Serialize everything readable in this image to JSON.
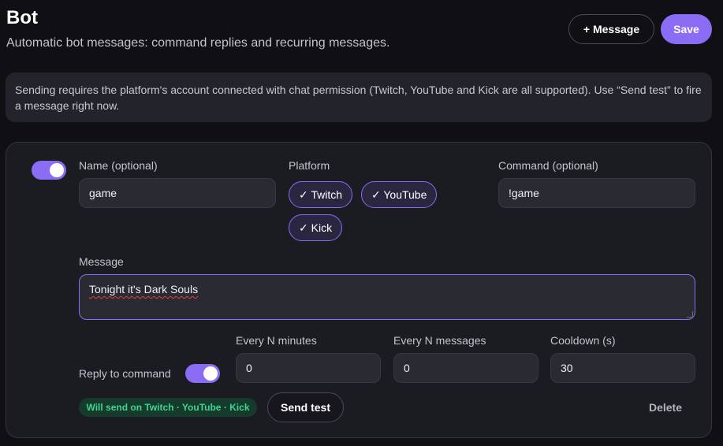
{
  "header": {
    "title": "Bot",
    "subtitle": "Automatic bot messages: command replies and recurring messages.",
    "add_message_label": "+ Message",
    "save_label": "Save"
  },
  "notice": {
    "text": "Sending requires the platform's account connected with chat permission (Twitch, YouTube and Kick are all supported). Use “Send test” to fire a message right now."
  },
  "colors": {
    "accent": "#8b6cf5",
    "background": "#0f0f14",
    "card": "#1b1b22",
    "success": "#3fd48f"
  },
  "bot_message": {
    "enabled": true,
    "name_label": "Name (optional)",
    "name_value": "game",
    "platform_label": "Platform",
    "platforms": [
      {
        "label": "✓ Twitch",
        "selected": true
      },
      {
        "label": "✓ YouTube",
        "selected": true
      },
      {
        "label": "✓ Kick",
        "selected": true
      }
    ],
    "command_label": "Command (optional)",
    "command_value": "!game",
    "message_label": "Message",
    "message_value": "Tonight it's Dark Souls",
    "reply_to_command_label": "Reply to command",
    "reply_to_command": true,
    "every_n_minutes_label": "Every N minutes",
    "every_n_minutes_value": "0",
    "every_n_messages_label": "Every N messages",
    "every_n_messages_value": "0",
    "cooldown_label": "Cooldown (s)",
    "cooldown_value": "30",
    "will_send_badge": "Will send on Twitch · YouTube · Kick",
    "send_test_label": "Send test",
    "delete_label": "Delete"
  }
}
